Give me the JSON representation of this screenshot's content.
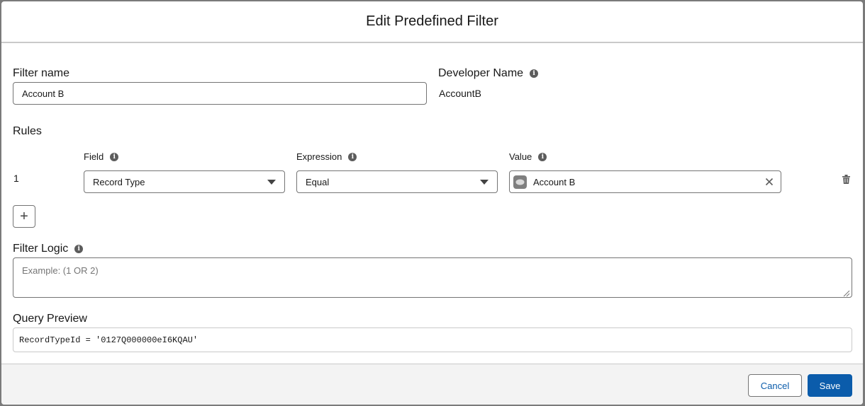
{
  "modal": {
    "title": "Edit Predefined Filter"
  },
  "filter_name": {
    "label": "Filter name",
    "value": "Account B"
  },
  "developer_name": {
    "label": "Developer Name",
    "value": "AccountB"
  },
  "rules": {
    "heading": "Rules",
    "columns": {
      "field": "Field",
      "expression": "Expression",
      "value": "Value"
    },
    "items": [
      {
        "number": "1",
        "field": "Record Type",
        "expression": "Equal",
        "value": "Account B"
      }
    ],
    "add_button": "+"
  },
  "filter_logic": {
    "label": "Filter Logic",
    "placeholder": "Example: (1 OR 2)"
  },
  "query_preview": {
    "label": "Query Preview",
    "value": "RecordTypeId = '0127Q000000eI6KQAU'"
  },
  "footer": {
    "cancel_label": "Cancel",
    "save_label": "Save"
  },
  "colors": {
    "brand": "#0b5cab",
    "border": "#747474",
    "info_icon": "#5c5c5c"
  }
}
